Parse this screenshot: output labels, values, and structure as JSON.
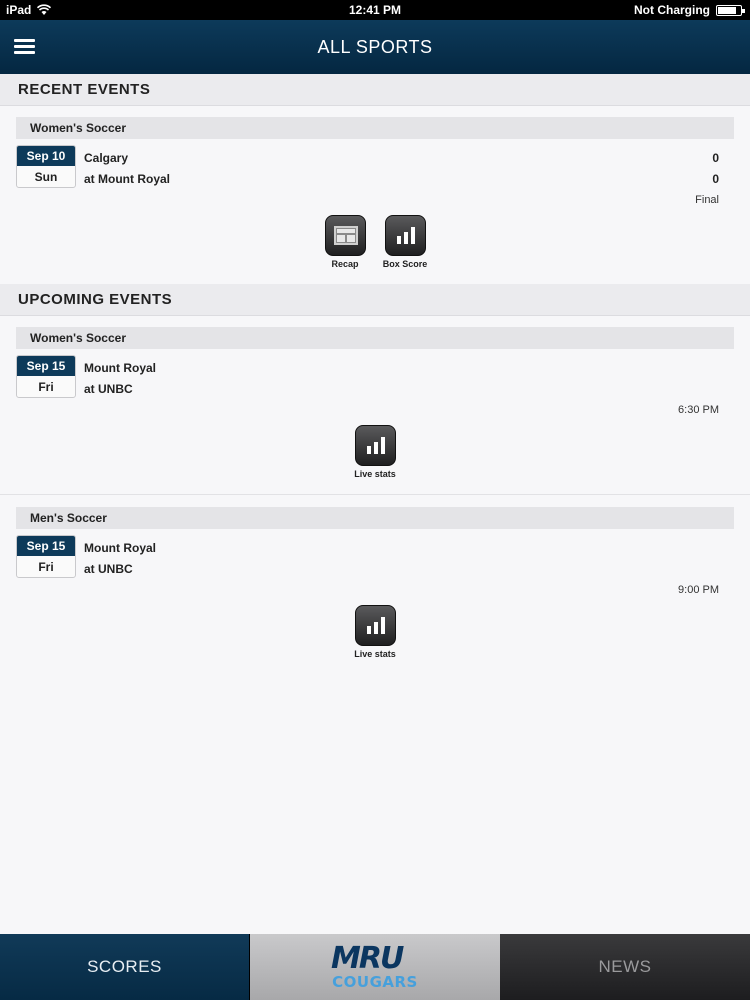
{
  "status_bar": {
    "device": "iPad",
    "time": "12:41 PM",
    "charging": "Not Charging"
  },
  "header": {
    "title": "ALL SPORTS"
  },
  "recent": {
    "heading": "RECENT EVENTS",
    "events": [
      {
        "sport": "Women's Soccer",
        "month_day": "Sep 10",
        "weekday": "Sun",
        "home": "Calgary",
        "away": "at Mount Royal",
        "home_score": "0",
        "away_score": "0",
        "status": "Final",
        "actions": [
          "Recap",
          "Box Score"
        ]
      }
    ]
  },
  "upcoming": {
    "heading": "UPCOMING EVENTS",
    "events": [
      {
        "sport": "Women's Soccer",
        "month_day": "Sep 15",
        "weekday": "Fri",
        "home": "Mount Royal",
        "away": "at UNBC",
        "time": "6:30 PM",
        "actions": [
          "Live stats"
        ]
      },
      {
        "sport": "Men's Soccer",
        "month_day": "Sep 15",
        "weekday": "Fri",
        "home": "Mount Royal",
        "away": "at UNBC",
        "time": "9:00 PM",
        "actions": [
          "Live stats"
        ]
      }
    ]
  },
  "tabs": {
    "scores": "SCORES",
    "logo_top": "MRU",
    "logo_bottom": "COUGARS",
    "news": "NEWS"
  },
  "colors": {
    "navy": "#0d3a5a",
    "accent_blue": "#46a0dc"
  }
}
